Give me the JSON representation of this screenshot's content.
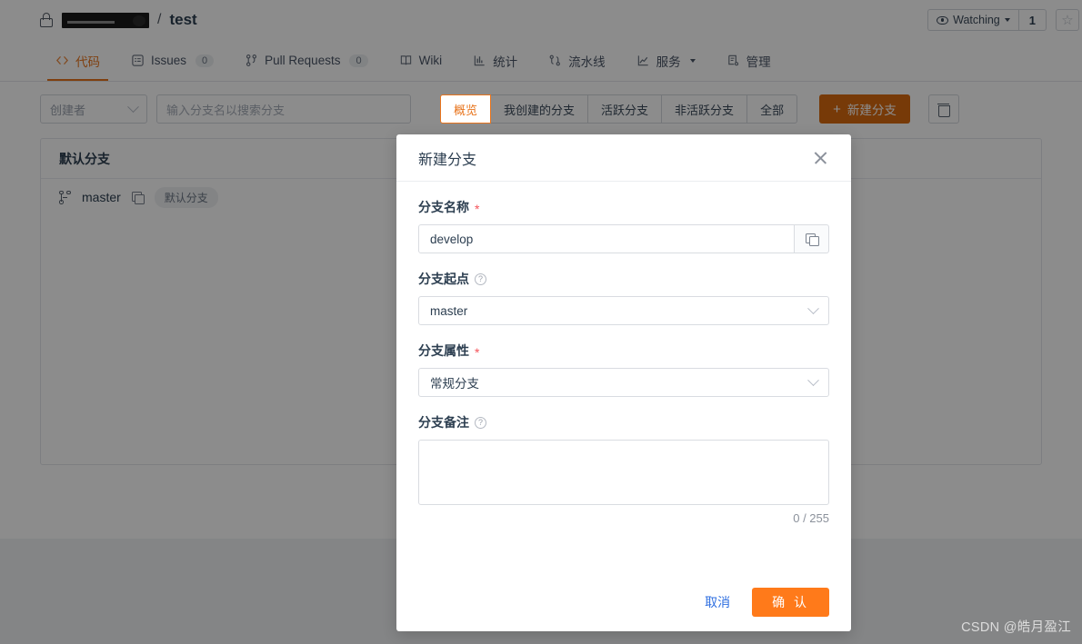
{
  "header": {
    "lock_icon": "lock-icon",
    "org_name_redacted": "",
    "separator": "/",
    "repo_name": "test",
    "watching_label": "Watching",
    "watching_count": "1",
    "star_icon": "star-icon",
    "eye_icon": "eye-icon"
  },
  "nav": {
    "items": [
      {
        "label": "代码",
        "icon": "code-icon",
        "badge": null,
        "active": true,
        "caret": false
      },
      {
        "label": "Issues",
        "icon": "issues-icon",
        "badge": "0",
        "active": false,
        "caret": false
      },
      {
        "label": "Pull Requests",
        "icon": "pull-request-icon",
        "badge": "0",
        "active": false,
        "caret": false
      },
      {
        "label": "Wiki",
        "icon": "book-icon",
        "badge": null,
        "active": false,
        "caret": false
      },
      {
        "label": "统计",
        "icon": "bar-chart-icon",
        "badge": null,
        "active": false,
        "caret": false
      },
      {
        "label": "流水线",
        "icon": "pipeline-icon",
        "badge": null,
        "active": false,
        "caret": false
      },
      {
        "label": "服务",
        "icon": "line-chart-icon",
        "badge": null,
        "active": false,
        "caret": true
      },
      {
        "label": "管理",
        "icon": "settings-list-icon",
        "badge": null,
        "active": false,
        "caret": false
      }
    ]
  },
  "toolbar": {
    "creator_select": "创建者",
    "search_placeholder": "输入分支名以搜索分支",
    "filters": [
      {
        "label": "概览",
        "active": true
      },
      {
        "label": "我创建的分支",
        "active": false
      },
      {
        "label": "活跃分支",
        "active": false
      },
      {
        "label": "非活跃分支",
        "active": false
      },
      {
        "label": "全部",
        "active": false
      }
    ],
    "new_branch_label": "新建分支",
    "new_branch_plus": "+",
    "delete_icon": "trash-icon"
  },
  "branch_card": {
    "section_title": "默认分支",
    "rows": [
      {
        "branch_icon": "branch-icon",
        "name": "master",
        "copy_icon": "copy-icon",
        "tag": "默认分支"
      }
    ]
  },
  "modal": {
    "title": "新建分支",
    "close_icon": "close-icon",
    "fields": {
      "branch_name": {
        "label": "分支名称",
        "required_mark": "*",
        "value": "develop",
        "copy_icon": "copy-icon"
      },
      "branch_source": {
        "label": "分支起点",
        "help_icon": "?",
        "value": "master"
      },
      "branch_property": {
        "label": "分支属性",
        "required_mark": "*",
        "value": "常规分支"
      },
      "branch_remark": {
        "label": "分支备注",
        "help_icon": "?",
        "value": "",
        "counter": "0 / 255"
      }
    },
    "cancel_label": "取消",
    "confirm_label": "确 认"
  },
  "watermark": "CSDN @皓月盈江",
  "colors": {
    "accent_orange": "#e8741c",
    "confirm_orange": "#ff7a1a",
    "new_branch_orange": "#d96a10",
    "link_blue": "#2f6fe0",
    "required_red": "#f5545b"
  }
}
